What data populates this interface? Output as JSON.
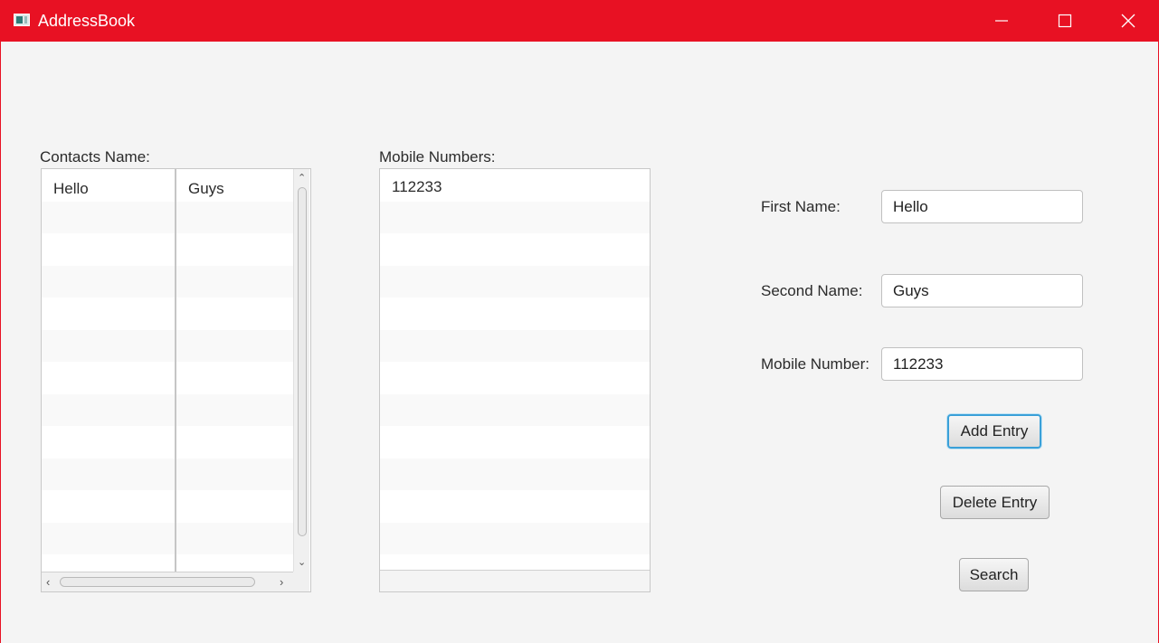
{
  "window": {
    "title": "AddressBook"
  },
  "contacts": {
    "label": "Contacts Name:",
    "rows": [
      {
        "first": "Hello",
        "second": "Guys"
      }
    ]
  },
  "mobiles": {
    "label": "Mobile Numbers:",
    "rows": [
      "112233"
    ]
  },
  "form": {
    "first_name_label": "First Name:",
    "first_name_value": "Hello",
    "second_name_label": "Second Name:",
    "second_name_value": "Guys",
    "mobile_label": "Mobile Number:",
    "mobile_value": "112233"
  },
  "buttons": {
    "add": "Add Entry",
    "delete": "Delete Entry",
    "search": "Search"
  },
  "colors": {
    "titlebar": "#e81123",
    "focus": "#3aa0d8"
  },
  "icons": [
    "app-icon",
    "minimize-icon",
    "maximize-icon",
    "close-icon",
    "chevron-up-icon",
    "chevron-down-icon",
    "chevron-left-icon",
    "chevron-right-icon"
  ]
}
